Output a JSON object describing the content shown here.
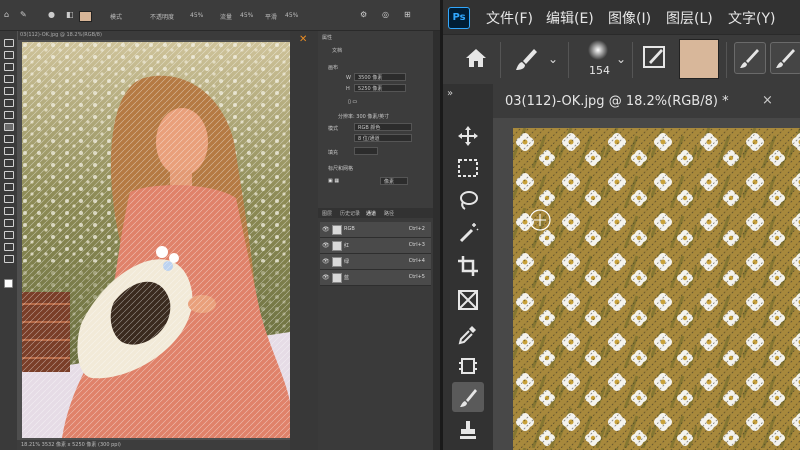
{
  "left": {
    "options_bar": {
      "items": [
        "模式",
        "不透明度",
        "45%",
        "流量",
        "45%",
        "平滑",
        "45%"
      ]
    },
    "document_tab": "03(112)-OK.jpg @ 18.2%(RGB/8)",
    "status_text": "18.21%  3532 像素 x 5250 像素 (300 ppi)",
    "properties": {
      "title": "属性",
      "subtitle": "文档",
      "canvas_label": "画布",
      "width_label": "W",
      "width_value": "3500 像素",
      "height_label": "H",
      "height_value": "5250 像素",
      "resolution": "分辨率: 300 像素/英寸",
      "mode_label": "模式",
      "mode_value": "RGB 颜色",
      "depth_value": "8 位/通道",
      "fill_label": "填充",
      "guides_label": "标尺和网格",
      "unit_value": "像素"
    },
    "layers_panel": {
      "tabs": [
        "图层",
        "历史记录",
        "通道",
        "路径"
      ],
      "rows": [
        {
          "name": "RGB",
          "shortcut": "Ctrl+2"
        },
        {
          "name": "红",
          "shortcut": "Ctrl+3"
        },
        {
          "name": "绿",
          "shortcut": "Ctrl+4"
        },
        {
          "name": "蓝",
          "shortcut": "Ctrl+5"
        }
      ]
    }
  },
  "right": {
    "app_logo": "Ps",
    "menu": [
      "文件(F)",
      "编辑(E)",
      "图像(I)",
      "图层(L)",
      "文字(Y)"
    ],
    "brush_size": "154",
    "foreground_color": "#d8b79a",
    "document_tab": "03(112)-OK.jpg @ 18.2%(RGB/8) *",
    "tab_close": "×",
    "tools_header": "»",
    "tools": [
      "move-icon",
      "marquee-icon",
      "lasso-icon",
      "magic-wand-icon",
      "crop-icon",
      "frame-icon",
      "eyedropper-icon",
      "healing-icon",
      "brush-icon",
      "stamp-icon"
    ]
  }
}
